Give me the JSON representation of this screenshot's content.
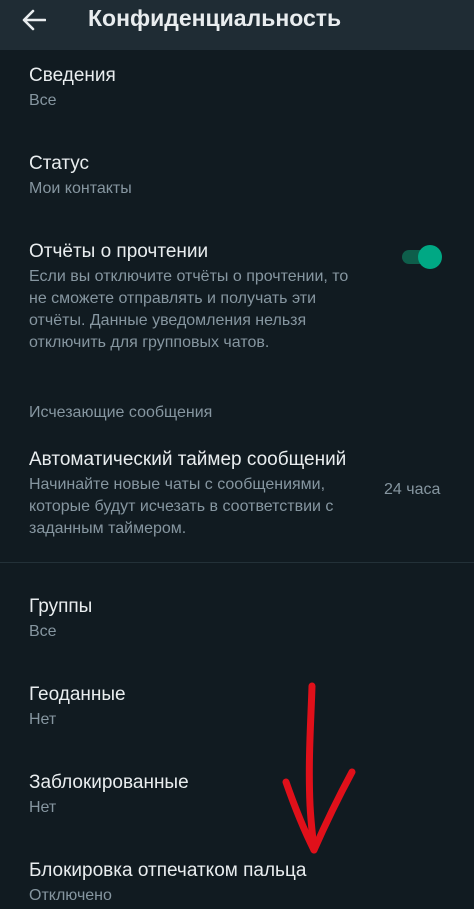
{
  "header": {
    "back_icon": "arrow-left-icon",
    "title": "Конфиденциальность"
  },
  "items": {
    "info": {
      "title": "Сведения",
      "value": "Все"
    },
    "status": {
      "title": "Статус",
      "value": "Мои контакты"
    },
    "read_receipts": {
      "title": "Отчёты о прочтении",
      "description": "Если вы отключите отчёты о прочтении, то не сможете отправлять и получать эти отчёты. Данные уведомления нельзя отключить для групповых чатов.",
      "enabled": true
    },
    "disappearing": {
      "section_header": "Исчезающие сообщения",
      "title": "Автоматический таймер сообщений",
      "description": "Начинайте новые чаты с сообщениями, которые будут исчезать в соответствии с заданным таймером.",
      "value": "24 часа"
    },
    "groups": {
      "title": "Группы",
      "value": "Все"
    },
    "location": {
      "title": "Геоданные",
      "value": "Нет"
    },
    "blocked": {
      "title": "Заблокированные",
      "value": "Нет"
    },
    "fingerprint": {
      "title": "Блокировка отпечатком пальца",
      "value": "Отключено"
    }
  },
  "colors": {
    "background": "#111b21",
    "appbar": "#1f2c34",
    "primary_text": "#e9edef",
    "secondary_text": "#8696a0",
    "accent": "#00a884",
    "annotation_arrow": "#e0101a"
  }
}
